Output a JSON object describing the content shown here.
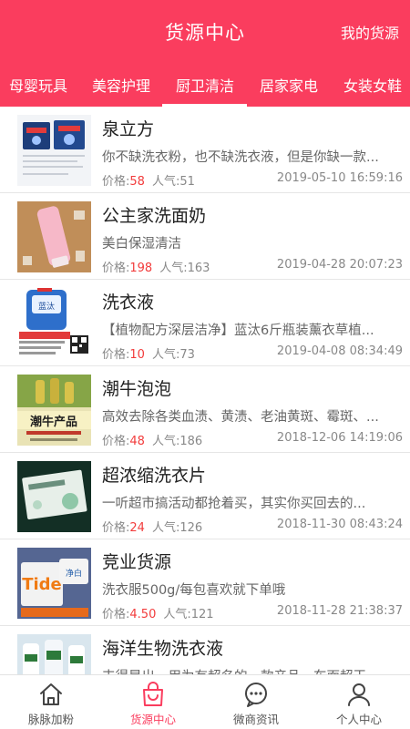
{
  "header": {
    "title": "货源中心",
    "right_link": "我的货源"
  },
  "tabs": [
    {
      "label": "母婴玩具",
      "active": false
    },
    {
      "label": "美容护理",
      "active": false
    },
    {
      "label": "厨卫清洁",
      "active": true
    },
    {
      "label": "居家家电",
      "active": false
    },
    {
      "label": "女装女鞋",
      "active": false
    }
  ],
  "labels": {
    "price": "价格:",
    "popularity": "人气:"
  },
  "items": [
    {
      "title": "泉立方",
      "desc": "你不缺洗衣粉，也不缺洗衣液，但是你缺一款...",
      "price": "58",
      "popularity": "51",
      "date": "2019-05-10 16:59:16"
    },
    {
      "title": "公主家洗面奶",
      "desc": "美白保湿清洁",
      "price": "198",
      "popularity": "163",
      "date": "2019-04-28 20:07:23"
    },
    {
      "title": "洗衣液",
      "desc": "【植物配方深层洁净】蓝汰6斤瓶装薰衣草植...",
      "price": "10",
      "popularity": "73",
      "date": "2019-04-08 08:34:49"
    },
    {
      "title": "潮牛泡泡",
      "desc": "高效去除各类血渍、黄渍、老油黄斑、霉斑、...",
      "price": "48",
      "popularity": "186",
      "date": "2018-12-06 14:19:06"
    },
    {
      "title": "超浓缩洗衣片",
      "desc": "一听超市搞活动都抢着买，其实你买回去的...",
      "price": "24",
      "popularity": "126",
      "date": "2018-11-30 08:43:24"
    },
    {
      "title": "竞业货源",
      "desc": "洗衣服500g/每包喜欢就下单哦",
      "price": "4.50",
      "popularity": "121",
      "date": "2018-11-28 21:38:37"
    },
    {
      "title": "海洋生物洗衣液",
      "desc": "丰得是出，用为有超名的一款产品，车面超干",
      "price": "",
      "popularity": "",
      "date": ""
    }
  ],
  "thumb_text": {
    "item3": "蓝汰",
    "item4": "潮牛产品",
    "item6_brand": "Tide",
    "item6_sub": "净白"
  },
  "bottom_nav": [
    {
      "label": "脉脉加粉",
      "icon": "home-icon",
      "active": false
    },
    {
      "label": "货源中心",
      "icon": "shopping-bag-icon",
      "active": true
    },
    {
      "label": "微商资讯",
      "icon": "chat-bubble-icon",
      "active": false
    },
    {
      "label": "个人中心",
      "icon": "person-icon",
      "active": false
    }
  ],
  "colors": {
    "accent": "#fa3d5e",
    "price": "#f23c3c",
    "text": "#222222",
    "muted": "#888888"
  }
}
